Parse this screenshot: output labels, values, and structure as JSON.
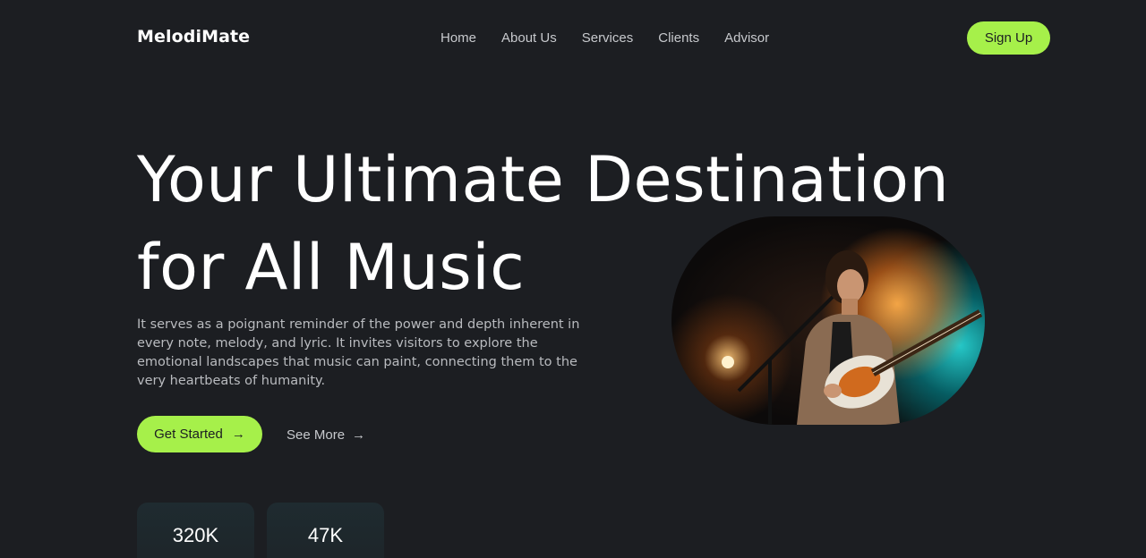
{
  "brand": "MelodiMate",
  "nav": [
    "Home",
    "About Us",
    "Services",
    "Clients",
    "Advisor"
  ],
  "signup_label": "Sign Up",
  "hero": {
    "title_line1": "Your Ultimate Destination",
    "title_line2": "for All Music",
    "description": "It serves as a poignant reminder of the power and depth inherent in every note, melody, and lyric. It invites visitors to explore the emotional landscapes that music can paint, connecting them to the very heartbeats of humanity.",
    "get_started_label": "Get Started",
    "see_more_label": "See More",
    "arrow_icon": "→"
  },
  "stats": [
    {
      "value": "320K"
    },
    {
      "value": "47K"
    }
  ],
  "colors": {
    "background": "#1c1e22",
    "accent": "#a6f04a"
  }
}
